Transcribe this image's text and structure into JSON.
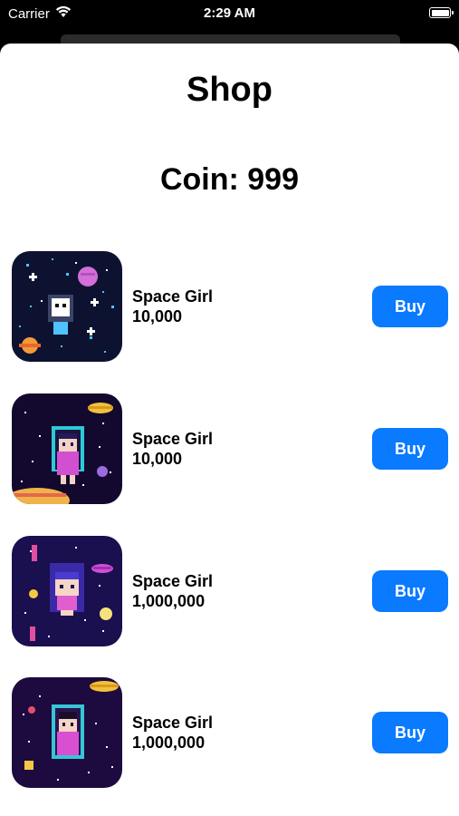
{
  "status": {
    "carrier": "Carrier",
    "time": "2:29 AM",
    "wifi_icon": "wifi-icon",
    "battery_icon": "battery-icon"
  },
  "shop": {
    "title": "Shop",
    "coin_label": "Coin: 999",
    "items": [
      {
        "name": "Space Girl",
        "price": "10,000",
        "buy_label": "Buy",
        "image": "space-girl-robot-image"
      },
      {
        "name": "Space Girl",
        "price": "10,000",
        "buy_label": "Buy",
        "image": "space-girl-teal-helmet-image"
      },
      {
        "name": "Space Girl",
        "price": "1,000,000",
        "buy_label": "Buy",
        "image": "space-girl-blue-hair-image"
      },
      {
        "name": "Space Girl",
        "price": "1,000,000",
        "buy_label": "Buy",
        "image": "space-girl-pink-helmet-image"
      }
    ]
  },
  "colors": {
    "accent": "#0a7aff",
    "background": "#ffffff"
  }
}
